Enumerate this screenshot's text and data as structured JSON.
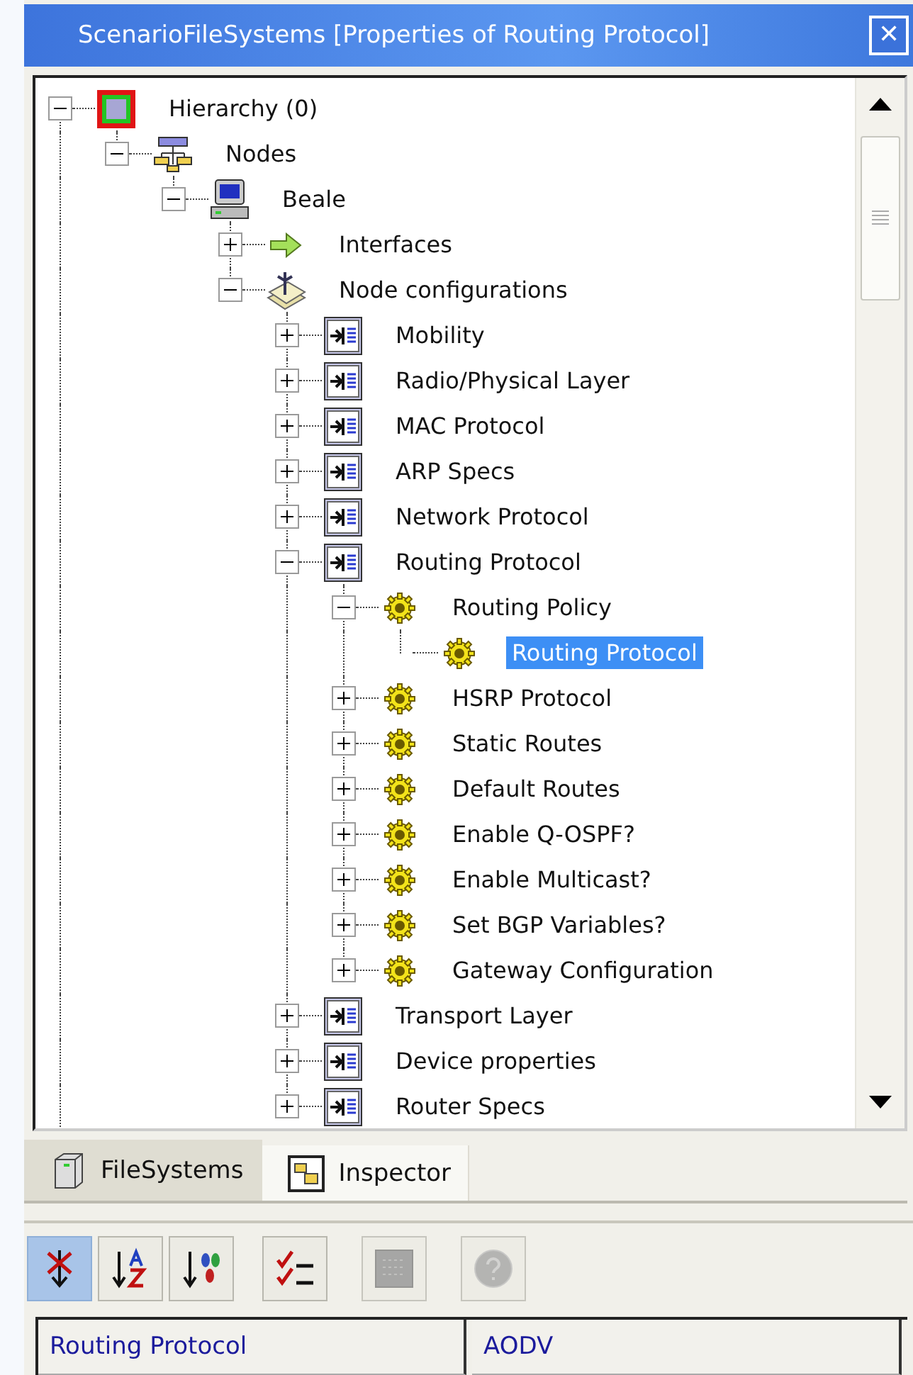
{
  "window": {
    "title": "ScenarioFileSystems [Properties of Routing Protocol]",
    "close": "✕"
  },
  "tree": [
    {
      "label": "Hierarchy (0)",
      "kind": "root",
      "has_children": true,
      "expanded": true,
      "selected": false,
      "children": [
        {
          "label": "Nodes",
          "kind": "nodes",
          "has_children": true,
          "expanded": true,
          "selected": false,
          "children": [
            {
              "label": "Beale",
              "kind": "computer",
              "has_children": true,
              "expanded": true,
              "selected": false,
              "children": [
                {
                  "label": "Interfaces",
                  "kind": "arrow",
                  "has_children": true,
                  "expanded": false,
                  "selected": false
                },
                {
                  "label": "Node configurations",
                  "kind": "stack",
                  "has_children": true,
                  "expanded": true,
                  "selected": false,
                  "children": [
                    {
                      "label": "Mobility",
                      "kind": "config",
                      "has_children": true,
                      "expanded": false,
                      "selected": false
                    },
                    {
                      "label": "Radio/Physical Layer",
                      "kind": "config",
                      "has_children": true,
                      "expanded": false,
                      "selected": false
                    },
                    {
                      "label": "MAC Protocol",
                      "kind": "config",
                      "has_children": true,
                      "expanded": false,
                      "selected": false
                    },
                    {
                      "label": "ARP Specs",
                      "kind": "config",
                      "has_children": true,
                      "expanded": false,
                      "selected": false
                    },
                    {
                      "label": "Network Protocol",
                      "kind": "config",
                      "has_children": true,
                      "expanded": false,
                      "selected": false
                    },
                    {
                      "label": "Routing Protocol",
                      "kind": "config",
                      "has_children": true,
                      "expanded": true,
                      "selected": false,
                      "children": [
                        {
                          "label": "Routing Policy",
                          "kind": "gear",
                          "has_children": true,
                          "expanded": true,
                          "selected": false,
                          "children": [
                            {
                              "label": "Routing Protocol",
                              "kind": "gear",
                              "has_children": false,
                              "selected": true
                            }
                          ]
                        },
                        {
                          "label": "HSRP Protocol",
                          "kind": "gear",
                          "has_children": true,
                          "expanded": false,
                          "selected": false
                        },
                        {
                          "label": "Static Routes",
                          "kind": "gear",
                          "has_children": true,
                          "expanded": false,
                          "selected": false
                        },
                        {
                          "label": "Default Routes",
                          "kind": "gear",
                          "has_children": true,
                          "expanded": false,
                          "selected": false
                        },
                        {
                          "label": "Enable Q-OSPF?",
                          "kind": "gear",
                          "has_children": true,
                          "expanded": false,
                          "selected": false
                        },
                        {
                          "label": "Enable Multicast?",
                          "kind": "gear",
                          "has_children": true,
                          "expanded": false,
                          "selected": false
                        },
                        {
                          "label": "Set BGP Variables?",
                          "kind": "gear",
                          "has_children": true,
                          "expanded": false,
                          "selected": false
                        },
                        {
                          "label": "Gateway Configuration",
                          "kind": "gear",
                          "has_children": true,
                          "expanded": false,
                          "selected": false
                        }
                      ]
                    },
                    {
                      "label": "Transport Layer",
                      "kind": "config",
                      "has_children": true,
                      "expanded": false,
                      "selected": false
                    },
                    {
                      "label": "Device properties",
                      "kind": "config",
                      "has_children": true,
                      "expanded": false,
                      "selected": false
                    },
                    {
                      "label": "Router Specs",
                      "kind": "config",
                      "has_children": true,
                      "expanded": false,
                      "selected": false
                    }
                  ]
                }
              ]
            }
          ]
        }
      ]
    }
  ],
  "tabs": [
    {
      "label": "FileSystems",
      "kind": "cube",
      "selected": true
    },
    {
      "label": "Inspector",
      "kind": "window",
      "selected": false
    }
  ],
  "toolbar": [
    {
      "kind": "categorized",
      "pressed": true,
      "disabled": false
    },
    {
      "kind": "alphabetical",
      "pressed": false,
      "disabled": false
    },
    {
      "kind": "sort",
      "pressed": false,
      "disabled": false
    },
    {
      "kind": "checklist",
      "pressed": false,
      "disabled": false
    },
    {
      "kind": "pages",
      "pressed": false,
      "disabled": true
    },
    {
      "kind": "help",
      "pressed": false,
      "disabled": true
    }
  ],
  "property": {
    "name": "Routing Protocol",
    "value": "AODV"
  }
}
